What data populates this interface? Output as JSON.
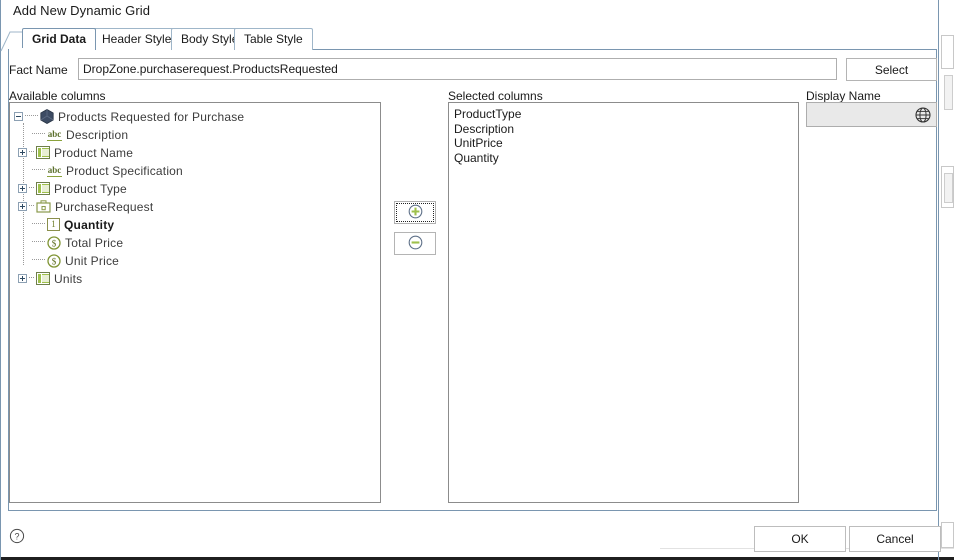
{
  "dialog": {
    "title": "Add New Dynamic Grid"
  },
  "tabs": [
    {
      "label": "Grid Data",
      "active": true
    },
    {
      "label": "Header Style",
      "active": false
    },
    {
      "label": "Body Style",
      "active": false
    },
    {
      "label": "Table Style",
      "active": false
    }
  ],
  "fact": {
    "label": "Fact Name",
    "value": "DropZone.purchaserequest.ProductsRequested",
    "placeholder": "",
    "select_button": "Select"
  },
  "available": {
    "label": "Available columns",
    "tree": [
      {
        "label": "Products Requested for Purchase",
        "icon": "hexagon-icon",
        "expander": "minus",
        "depth": 0,
        "bold": false
      },
      {
        "label": "Description",
        "icon": "abc-text-icon",
        "expander": "none",
        "depth": 1,
        "bold": false
      },
      {
        "label": "Product Name",
        "icon": "table-icon",
        "expander": "plus",
        "depth": 1,
        "bold": false
      },
      {
        "label": "Product Specification",
        "icon": "abc-text-icon",
        "expander": "none",
        "depth": 1,
        "bold": false
      },
      {
        "label": "Product Type",
        "icon": "table-icon",
        "expander": "plus",
        "depth": 1,
        "bold": false
      },
      {
        "label": "PurchaseRequest",
        "icon": "briefcase-icon",
        "expander": "plus",
        "depth": 1,
        "bold": false
      },
      {
        "label": "Quantity",
        "icon": "number-icon",
        "expander": "none",
        "depth": 1,
        "bold": true
      },
      {
        "label": "Total Price",
        "icon": "currency-icon",
        "expander": "none",
        "depth": 1,
        "bold": false
      },
      {
        "label": "Unit Price",
        "icon": "currency-icon",
        "expander": "none",
        "depth": 1,
        "bold": false
      },
      {
        "label": "Units",
        "icon": "table-icon",
        "expander": "plus",
        "depth": 1,
        "bold": false
      }
    ]
  },
  "transfer": {
    "add_icon": "plus-circle-icon",
    "remove_icon": "minus-circle-icon"
  },
  "selected": {
    "label": "Selected columns",
    "items": [
      "ProductType",
      "Description",
      "UnitPrice",
      "Quantity"
    ]
  },
  "display_name": {
    "label": "Display Name",
    "value": "",
    "placeholder": "",
    "globe_icon": "globe-icon"
  },
  "footer": {
    "help_icon": "help-circle-icon",
    "ok": "OK",
    "cancel": "Cancel"
  },
  "colors": {
    "dialog_border": "#7a96b0",
    "tab_border": "#9fb6c9",
    "listbox_border": "#8c8c8c",
    "icon_green": "#9fc14c",
    "icon_navy": "#3d4b63",
    "disabled_field": "#e9e9e9"
  }
}
